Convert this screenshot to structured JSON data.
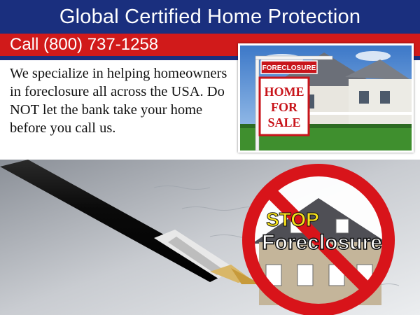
{
  "header": {
    "title": "Global Certified Home Protection"
  },
  "phone": {
    "label": "Call (800) 737-1258"
  },
  "intro": {
    "text": "We specialize in helping homeowners in foreclosure all across the USA. Do NOT let the bank take your home before you call us."
  },
  "sign": {
    "top": "FORECLOSURE",
    "line1": "HOME",
    "line2": "FOR",
    "line3": "SALE"
  },
  "stop_sign": {
    "word1": "STOP",
    "word2": "Foreclosure"
  },
  "colors": {
    "navy": "#1a2f7e",
    "red": "#d11a1a",
    "stop_yellow": "#f7e21b"
  }
}
